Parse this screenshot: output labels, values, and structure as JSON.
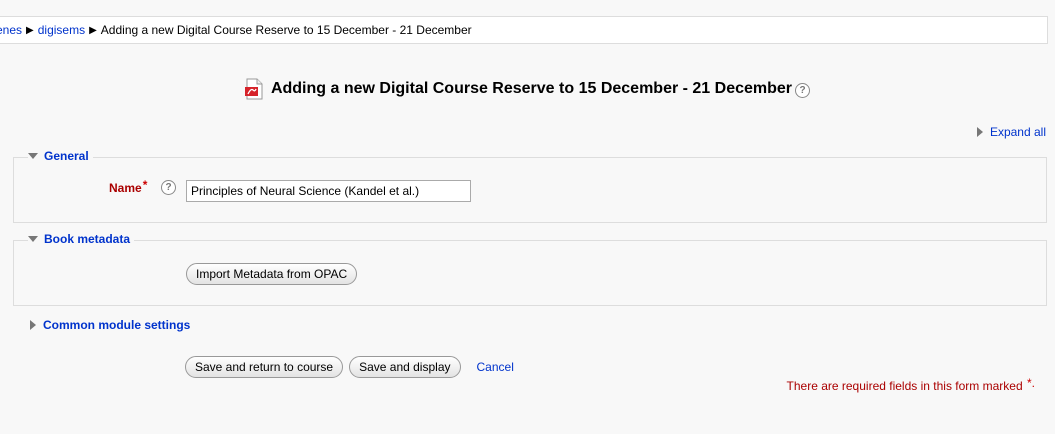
{
  "breadcrumb": {
    "items": [
      {
        "label": "enes",
        "link": true
      },
      {
        "label": "digisems",
        "link": true
      },
      {
        "label": "Adding a new Digital Course Reserve to 15 December - 21 December",
        "link": false
      }
    ]
  },
  "page": {
    "title": "Adding a new Digital Course Reserve to 15 December - 21 December",
    "expand_all": "Expand all"
  },
  "general": {
    "legend": "General",
    "name_label": "Name",
    "required_marker": "*",
    "name_value": "Principles of Neural Science (Kandel et al.)"
  },
  "book_metadata": {
    "legend": "Book metadata",
    "import_button": "Import Metadata from OPAC"
  },
  "common_module": {
    "legend": "Common module settings"
  },
  "actions": {
    "save_return": "Save and return to course",
    "save_display": "Save and display",
    "cancel": "Cancel"
  },
  "required_note": "There are required fields in this form marked",
  "required_note_marker": "*.",
  "colors": {
    "link": "#0033cc",
    "required": "#aa0000",
    "background": "#f8f8f8"
  },
  "icons": {
    "page_icon": "pdf-icon",
    "help": "help-icon"
  }
}
